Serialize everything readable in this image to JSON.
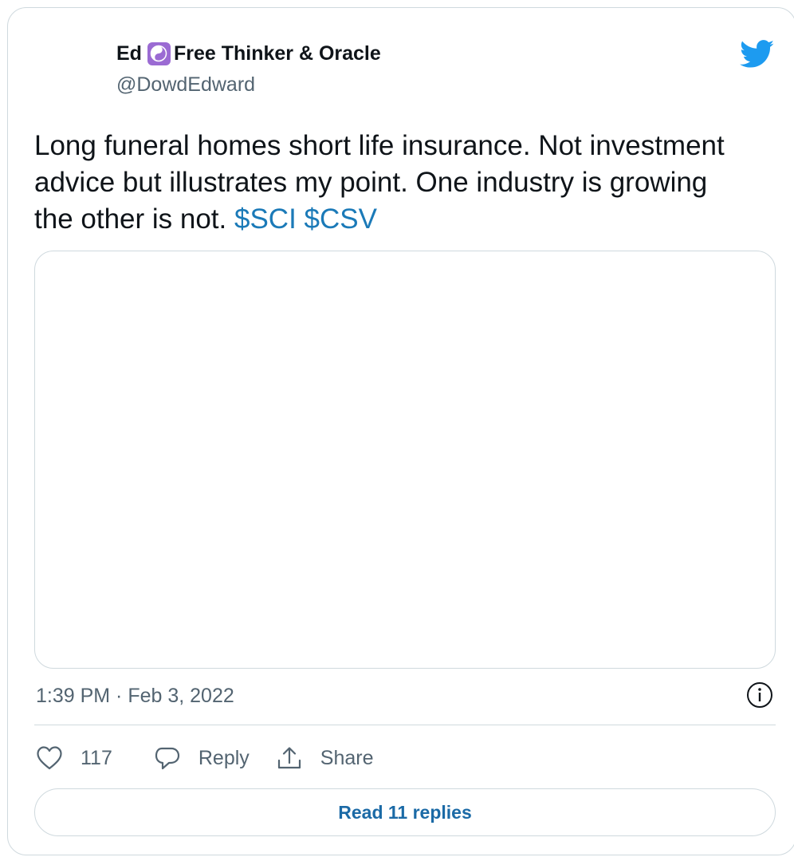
{
  "author": {
    "name": "Ed",
    "name_suffix": "Free Thinker & Oracle",
    "handle": "@DowdEdward"
  },
  "tweet": {
    "text": "Long funeral homes short life insurance. Not investment advice but illustrates my point. One industry is growing the other is not. ",
    "cashtags": [
      "$SCI",
      "$CSV"
    ]
  },
  "meta": {
    "timestamp": "1:39 PM · Feb 3, 2022"
  },
  "actions": {
    "likes_count": "117",
    "reply_label": "Reply",
    "share_label": "Share"
  },
  "read_replies_label": "Read 11 replies",
  "colors": {
    "brand_blue": "#1d9bf0",
    "link": "#1b7ab8",
    "secondary_text": "#536471",
    "border": "#cfd9de",
    "emoji_bg": "#9b6bd3"
  },
  "icons": {
    "brand": "twitter-bird-icon",
    "emoji": "yin-yang-icon",
    "info": "info-icon",
    "like": "heart-icon",
    "reply": "speech-bubble-icon",
    "share": "share-icon"
  }
}
